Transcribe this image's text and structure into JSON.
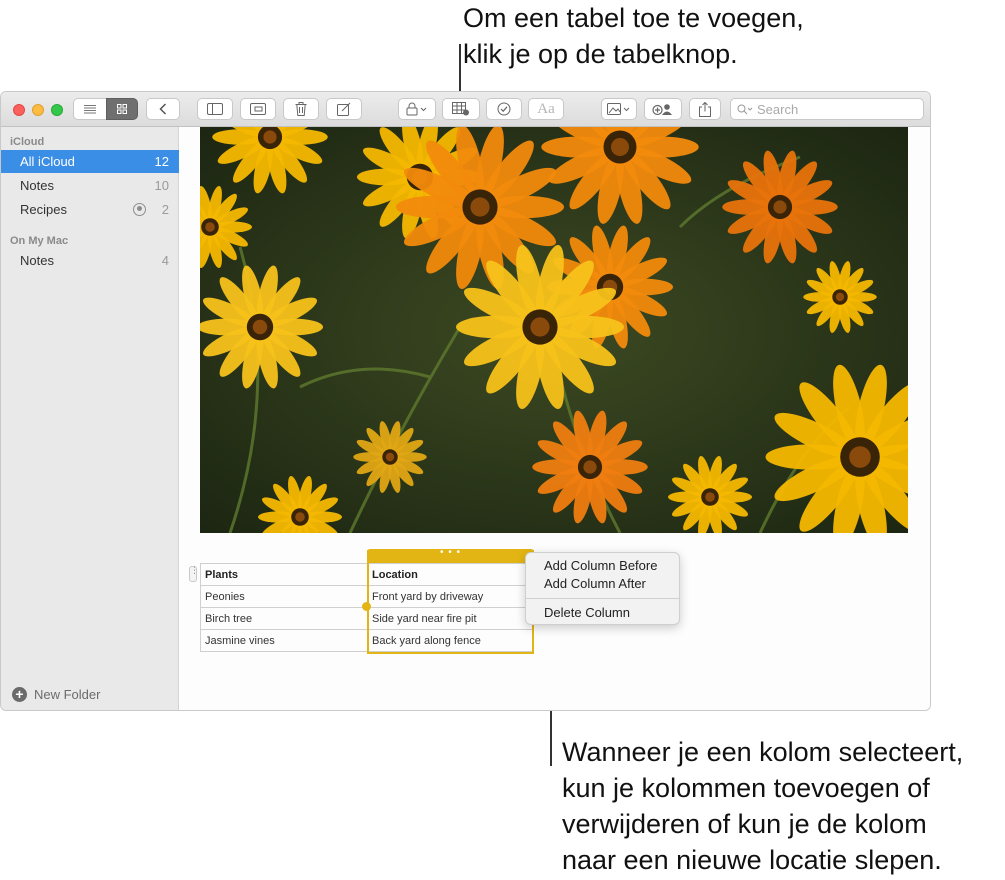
{
  "callouts": {
    "top_line1": "Om een tabel toe te voegen,",
    "top_line2": "klik je op de tabelknop.",
    "bottom_line1": "Wanneer je een kolom selecteert,",
    "bottom_line2": "kun je kolommen toevoegen of",
    "bottom_line3": "verwijderen of kun je de kolom",
    "bottom_line4": "naar een nieuwe locatie slepen."
  },
  "toolbar": {
    "font_button_label": "Aa",
    "search_placeholder": "Search"
  },
  "sidebar": {
    "icloud_header": "iCloud",
    "icloud_items": [
      {
        "label": "All iCloud",
        "count": "12"
      },
      {
        "label": "Notes",
        "count": "10"
      },
      {
        "label": "Recipes",
        "count": "2"
      }
    ],
    "mac_header": "On My Mac",
    "mac_items": [
      {
        "label": "Notes",
        "count": "4"
      }
    ],
    "new_folder_label": "New Folder"
  },
  "note": {
    "table": {
      "headers": [
        "Plants",
        "Location"
      ],
      "rows": [
        [
          "Peonies",
          "Front yard by driveway"
        ],
        [
          "Birch tree",
          "Side yard near fire pit"
        ],
        [
          "Jasmine vines",
          "Back yard along fence"
        ]
      ]
    },
    "column_handle": "• • •"
  },
  "context_menu": {
    "items": [
      "Add Column Before",
      "Add Column After",
      "Delete Column"
    ]
  },
  "colors": {
    "selection_blue": "#3a8ee6",
    "column_highlight": "#e3b514"
  }
}
